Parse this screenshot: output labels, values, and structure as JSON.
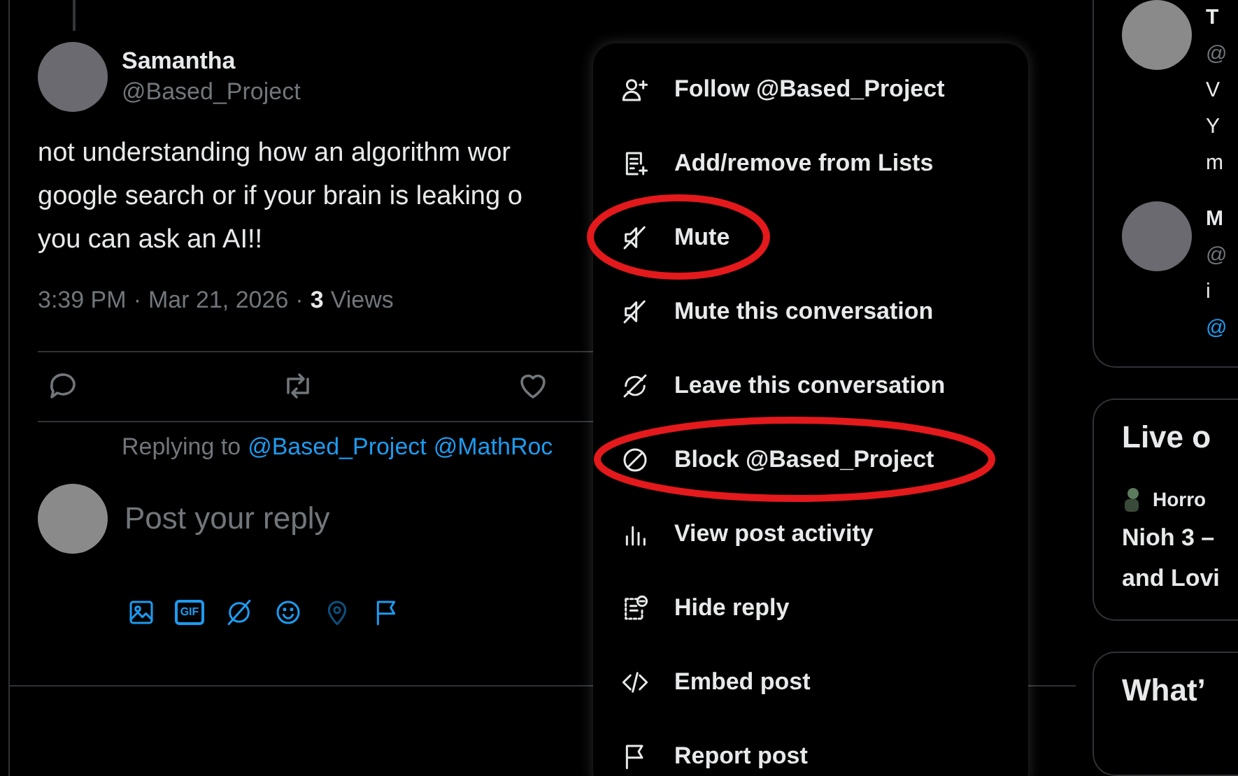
{
  "thread_post": {
    "author": {
      "name": "Samantha",
      "handle": "@Based_Project"
    },
    "text_lines": [
      "not understanding how an algorithm wor",
      "google search or if your brain is leaking o",
      "you can ask an AI!!"
    ],
    "time": "3:39 PM",
    "separators": [
      "·",
      "·"
    ],
    "date": "Mar 21, 2026",
    "views_count": "3",
    "views_label": "Views"
  },
  "reply_box": {
    "replying_label": "Replying to",
    "mentions": [
      "@Based_Project",
      "@MathRoc"
    ],
    "placeholder": "Post your reply",
    "tools": [
      {
        "kind": "image",
        "disabled": false
      },
      {
        "kind": "gif",
        "label": "GIF",
        "disabled": false
      },
      {
        "kind": "grok",
        "disabled": false
      },
      {
        "kind": "emoji",
        "disabled": false
      },
      {
        "kind": "location",
        "disabled": true
      },
      {
        "kind": "flag",
        "disabled": false
      }
    ]
  },
  "post_menu": {
    "items": [
      {
        "label": "Follow @Based_Project",
        "circled": false
      },
      {
        "label": "Add/remove from Lists",
        "circled": false
      },
      {
        "label": "Mute",
        "circled": true
      },
      {
        "label": "Mute this conversation",
        "circled": false
      },
      {
        "label": "Leave this conversation",
        "circled": false
      },
      {
        "label": "Block @Based_Project",
        "circled": true
      },
      {
        "label": "View post activity",
        "circled": false
      },
      {
        "label": "Hide reply",
        "circled": false
      },
      {
        "label": "Embed post",
        "circled": false
      },
      {
        "label": "Report post",
        "circled": false
      }
    ]
  },
  "sidebar": {
    "conversation_card": {
      "posts": [
        {
          "name": "T",
          "handle": "@",
          "lines": [
            {
              "text": "V",
              "kind": "plain"
            },
            {
              "text": "Y",
              "kind": "plain"
            },
            {
              "text": "m",
              "kind": "plain"
            }
          ]
        },
        {
          "name": "M",
          "handle": "@",
          "lines": [
            {
              "text": "i",
              "kind": "plain"
            },
            {
              "text": "@",
              "kind": "mention"
            }
          ]
        }
      ]
    },
    "live_card": {
      "title": "Live o",
      "host": "Horro",
      "description_lines": [
        "Nioh 3 –",
        "and Lovi"
      ]
    },
    "trends_card": {
      "title": "What’"
    }
  }
}
